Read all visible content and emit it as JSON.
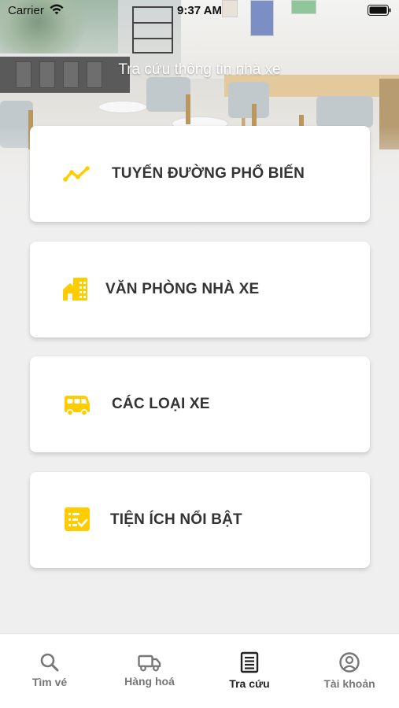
{
  "status_bar": {
    "carrier": "Carrier",
    "time": "9:37 AM"
  },
  "header": {
    "title": "Tra cứu thông tin nhà xe"
  },
  "menu": {
    "items": [
      {
        "label": "TUYẾN ĐƯỜNG PHỔ BIẾN",
        "icon": "trend-line-icon"
      },
      {
        "label": "VĂN PHÒNG NHÀ XE",
        "icon": "building-office-icon"
      },
      {
        "label": "CÁC LOẠI XE",
        "icon": "bus-icon"
      },
      {
        "label": "TIỆN ÍCH NỔI BẬT",
        "icon": "checklist-icon"
      }
    ]
  },
  "tab_bar": {
    "tabs": [
      {
        "label": "Tìm vé",
        "icon": "search-icon",
        "active": false
      },
      {
        "label": "Hàng hoá",
        "icon": "truck-icon",
        "active": false
      },
      {
        "label": "Tra cứu",
        "icon": "receipt-list-icon",
        "active": true
      },
      {
        "label": "Tài khoản",
        "icon": "user-circle-icon",
        "active": false
      }
    ]
  },
  "colors": {
    "accent": "#FFCC00",
    "card_text": "#333333",
    "background": "#EFEFEF",
    "tab_inactive": "#777777",
    "tab_active": "#222222"
  }
}
